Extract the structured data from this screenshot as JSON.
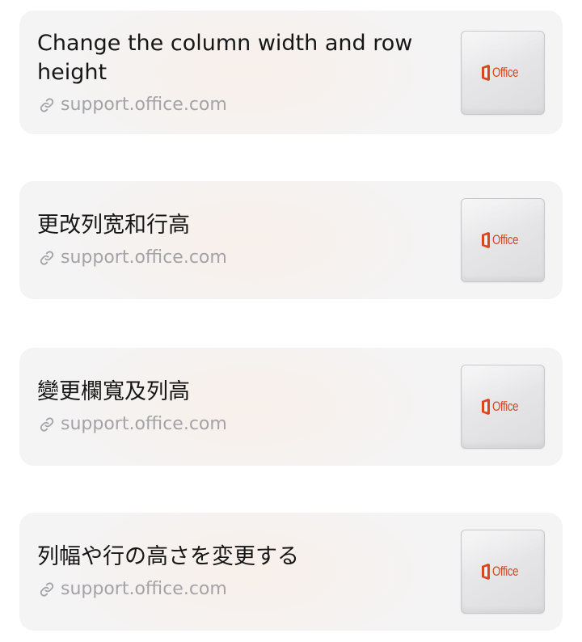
{
  "results": [
    {
      "title": "Change the column width and row height",
      "source": "support.office.com",
      "thumbnail_label": "Office"
    },
    {
      "title": "更改列宽和行高",
      "source": "support.office.com",
      "thumbnail_label": "Office"
    },
    {
      "title": "變更欄寬及列高",
      "source": "support.office.com",
      "thumbnail_label": "Office"
    },
    {
      "title": "列幅や行の高さを変更する",
      "source": "support.office.com",
      "thumbnail_label": "Office"
    }
  ],
  "colors": {
    "card_background": "#f4f4f5",
    "title_text": "#161616",
    "source_text": "#a3a3a8",
    "office_brand": "#d9481c"
  },
  "icons": {
    "source": "link-icon",
    "thumbnail": "office-logo-icon"
  }
}
